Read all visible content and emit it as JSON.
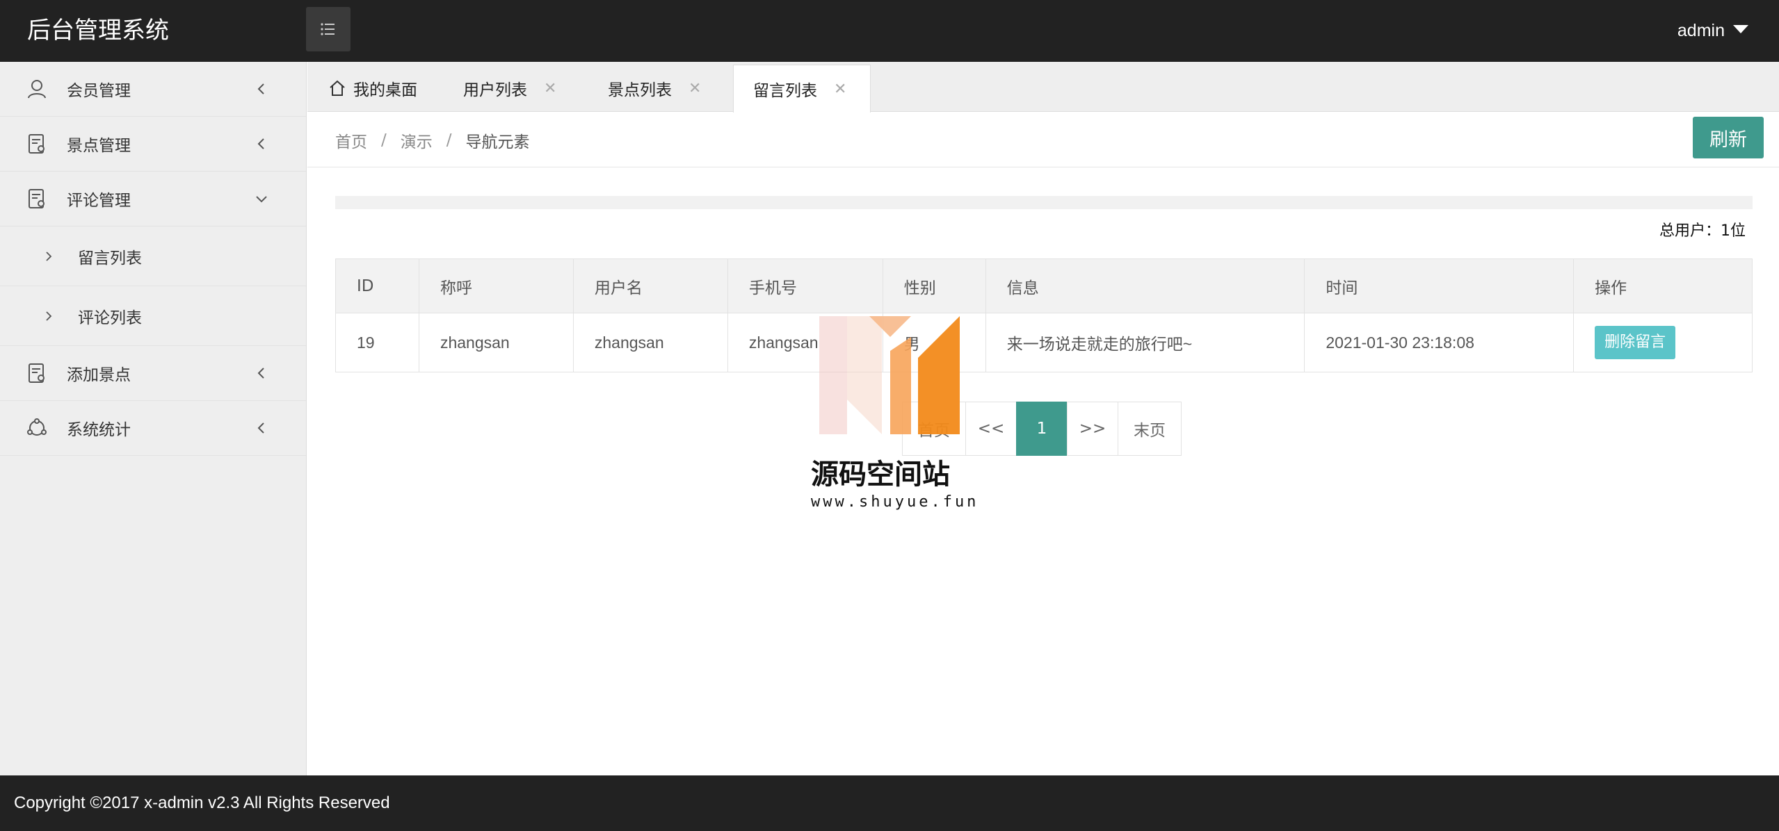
{
  "header": {
    "title": "后台管理系统",
    "user": "admin"
  },
  "sidebar": {
    "items": [
      {
        "label": "会员管理",
        "icon": "user-icon"
      },
      {
        "label": "景点管理",
        "icon": "document-icon"
      },
      {
        "label": "评论管理",
        "icon": "document-icon",
        "expanded": true,
        "children": [
          {
            "label": "留言列表"
          },
          {
            "label": "评论列表"
          }
        ]
      },
      {
        "label": "添加景点",
        "icon": "document-icon"
      },
      {
        "label": "系统统计",
        "icon": "network-icon"
      }
    ]
  },
  "tabs": [
    {
      "label": "我的桌面",
      "closable": false
    },
    {
      "label": "用户列表",
      "closable": true
    },
    {
      "label": "景点列表",
      "closable": true
    },
    {
      "label": "留言列表",
      "closable": true,
      "active": true
    }
  ],
  "breadcrumb": [
    "首页",
    "演示",
    "导航元素"
  ],
  "refresh_label": "刷新",
  "total_label": "总用户：1位",
  "table": {
    "columns": [
      "ID",
      "称呼",
      "用户名",
      "手机号",
      "性别",
      "信息",
      "时间",
      "操作"
    ],
    "rows": [
      [
        "19",
        "zhangsan",
        "zhangsan",
        "zhangsan",
        "男",
        "来一场说走就走的旅行吧~",
        "2021-01-30 23:18:08",
        "删除留言"
      ]
    ]
  },
  "pager": {
    "first": "首页",
    "prev": "<<",
    "current": "1",
    "next": ">>",
    "last": "末页"
  },
  "watermark": {
    "title": "源码空间站",
    "url": "www.shuyue.fun"
  },
  "footer": "Copyright ©2017 x-admin v2.3 All Rights Reserved",
  "colors": {
    "header_bg": "#222222",
    "accent": "#3f9a8d",
    "delete_button": "#5bc4c9"
  }
}
